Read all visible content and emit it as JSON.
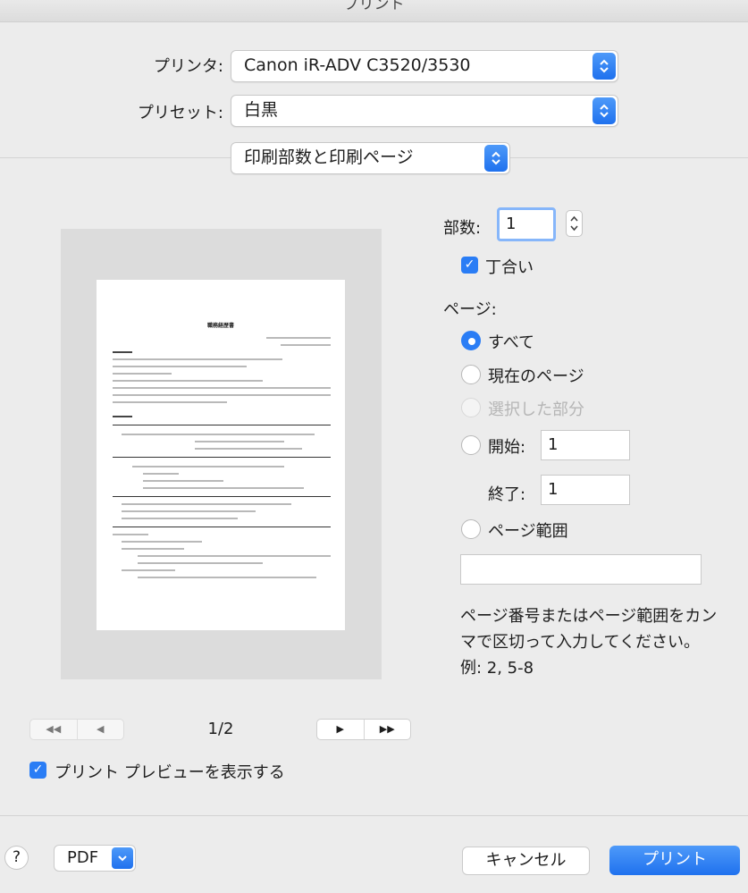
{
  "window": {
    "title": "プリント"
  },
  "printer": {
    "label": "プリンタ:",
    "value": "Canon iR-ADV C3520/3530"
  },
  "preset": {
    "label": "プリセット:",
    "value": "白黒"
  },
  "section": {
    "value": "印刷部数と印刷ページ"
  },
  "preview": {
    "doc_title": "職務経歴書",
    "page_indicator": "1/2",
    "show_preview_label": "プリント プレビューを表示する"
  },
  "copies": {
    "label": "部数:",
    "value": "1",
    "collate_label": "丁合い"
  },
  "pages": {
    "label": "ページ:",
    "options": {
      "all": "すべて",
      "current": "現在のページ",
      "selection": "選択した部分",
      "from": "開始:",
      "range": "ページ範囲"
    },
    "from_value": "1",
    "to_label": "終了:",
    "to_value": "1",
    "range_value": "",
    "help": "ページ番号またはページ範囲をカンマで区切って入力してください。例: 2, 5-8"
  },
  "footer": {
    "help_label": "?",
    "pdf_label": "PDF",
    "cancel_label": "キャンセル",
    "print_label": "プリント"
  },
  "colors": {
    "accent": "#2a7df5",
    "window_bg": "#ececec"
  }
}
